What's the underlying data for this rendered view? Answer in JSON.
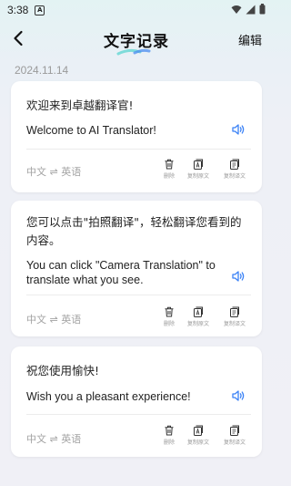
{
  "status": {
    "time": "3:38",
    "notif": "A"
  },
  "header": {
    "title": "文字记录",
    "edit_label": "编辑"
  },
  "date": "2024.11.14",
  "records": [
    {
      "source": "欢迎来到卓越翻译官!",
      "target": "Welcome to AI Translator!",
      "lang_pair": "中文 ⇌ 英语",
      "actions": {
        "delete": "删除",
        "copy_source": "复制原文",
        "copy_target": "复制译文"
      }
    },
    {
      "source": "您可以点击\"拍照翻译\"，轻松翻译您看到的内容。",
      "target": "You can click \"Camera Translation\" to translate what you see.",
      "lang_pair": "中文 ⇌ 英语",
      "actions": {
        "delete": "删除",
        "copy_source": "复制原文",
        "copy_target": "复制译文"
      }
    },
    {
      "source": "祝您使用愉快!",
      "target": "Wish you a pleasant experience!",
      "lang_pair": "中文 ⇌ 英语",
      "actions": {
        "delete": "删除",
        "copy_source": "复制原文",
        "copy_target": "复制译文"
      }
    }
  ],
  "colors": {
    "accent": "#3b82f6",
    "muted": "#a3a3a3"
  }
}
